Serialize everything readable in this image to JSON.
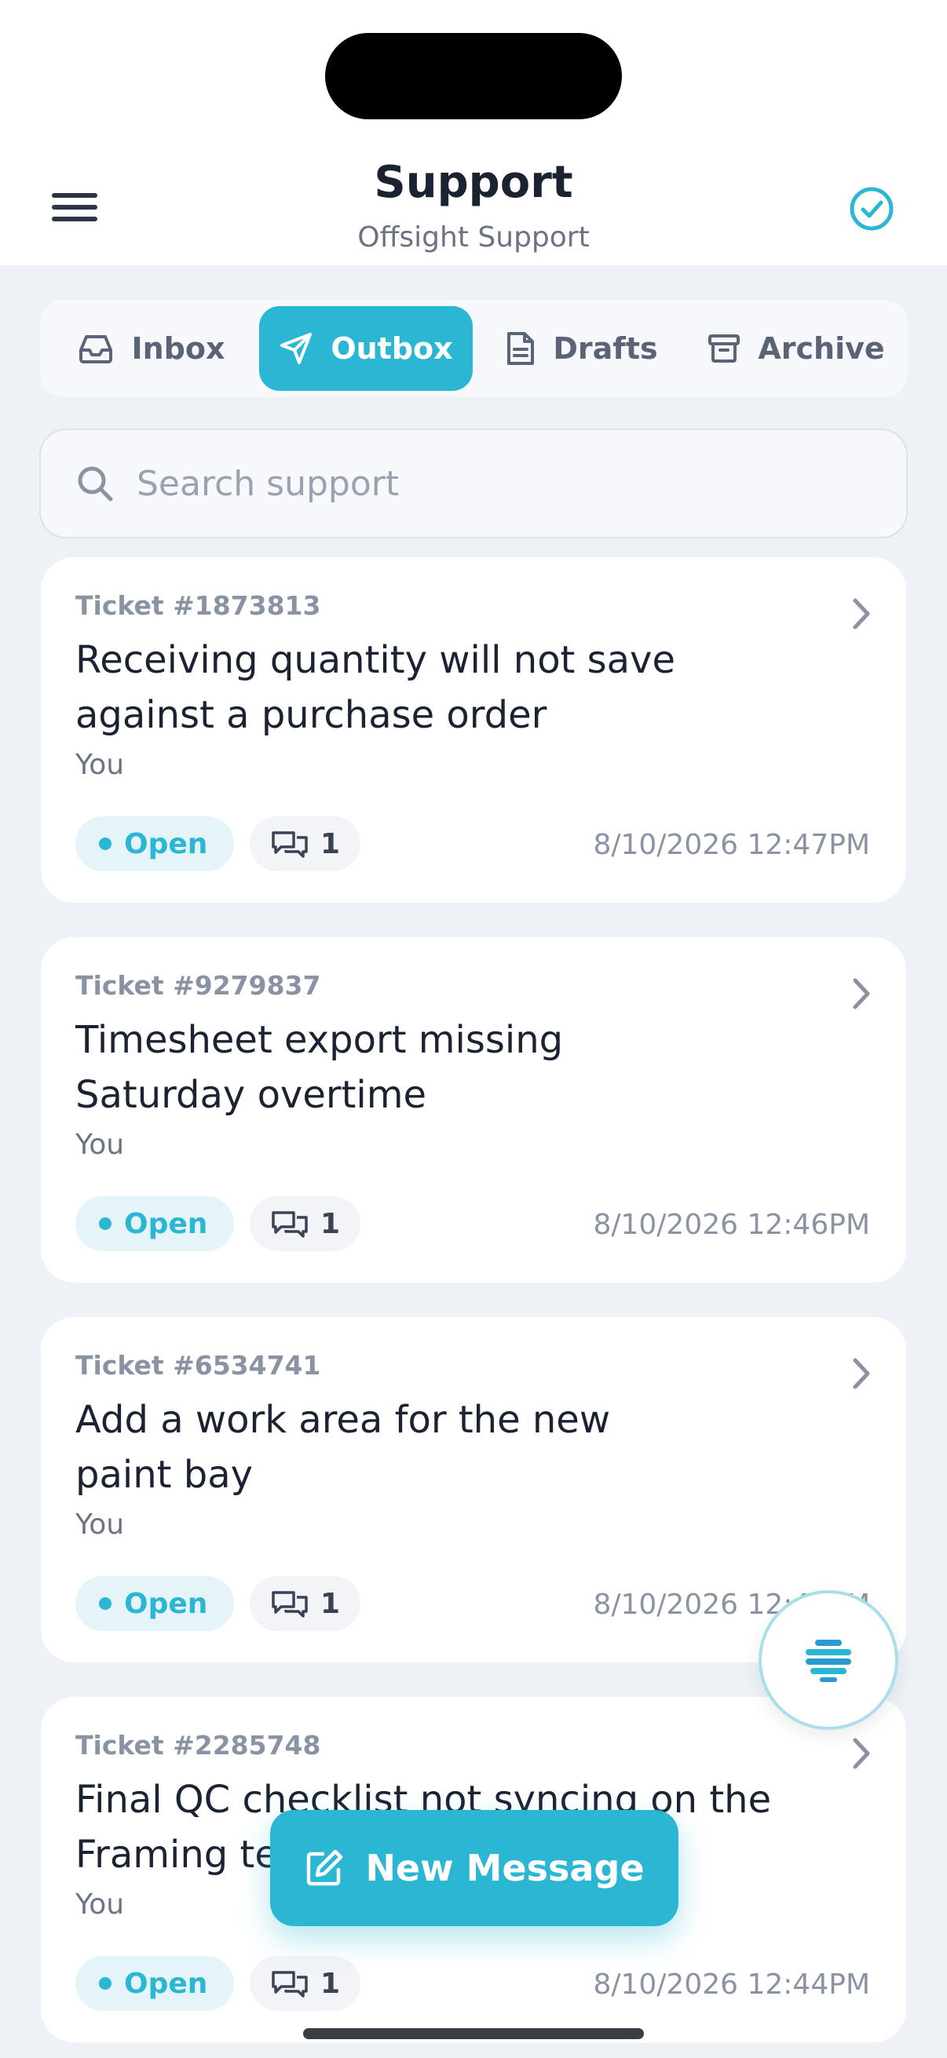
{
  "header": {
    "title": "Support",
    "subtitle": "Offsight Support",
    "menu_icon": "hamburger-menu-icon",
    "status_icon": "check-circle-icon"
  },
  "tabs": [
    {
      "label": "Inbox",
      "icon": "inbox-icon",
      "active": false
    },
    {
      "label": "Outbox",
      "icon": "send-icon",
      "active": true
    },
    {
      "label": "Drafts",
      "icon": "document-icon",
      "active": false
    },
    {
      "label": "Archive",
      "icon": "archive-icon",
      "active": false
    }
  ],
  "search": {
    "placeholder": "Search support",
    "value": ""
  },
  "tickets": [
    {
      "number": "Ticket #1873813",
      "title": "Receiving quantity will not save against a purchase order",
      "from": "You",
      "status": "Open",
      "comments": "1",
      "date": "8/10/2026 12:47PM"
    },
    {
      "number": "Ticket #9279837",
      "title": "Timesheet export missing Saturday overtime",
      "from": "You",
      "status": "Open",
      "comments": "1",
      "date": "8/10/2026 12:46PM"
    },
    {
      "number": "Ticket #6534741",
      "title": "Add a work area for the new paint bay",
      "from": "You",
      "status": "Open",
      "comments": "1",
      "date": "8/10/2026 12:45PM"
    },
    {
      "number": "Ticket #2285748",
      "title": "Final QC checklist not syncing on the Framing team",
      "from": "You",
      "status": "Open",
      "comments": "1",
      "date": "8/10/2026 12:44PM"
    }
  ],
  "new_message": {
    "label": "New Message",
    "icon": "compose-icon"
  },
  "assistant": {
    "icon": "assistant-bot-icon"
  },
  "colors": {
    "accent": "#2bb6d3",
    "background": "#eef1f6",
    "text": "#1b2333",
    "muted": "#8a93a3"
  }
}
